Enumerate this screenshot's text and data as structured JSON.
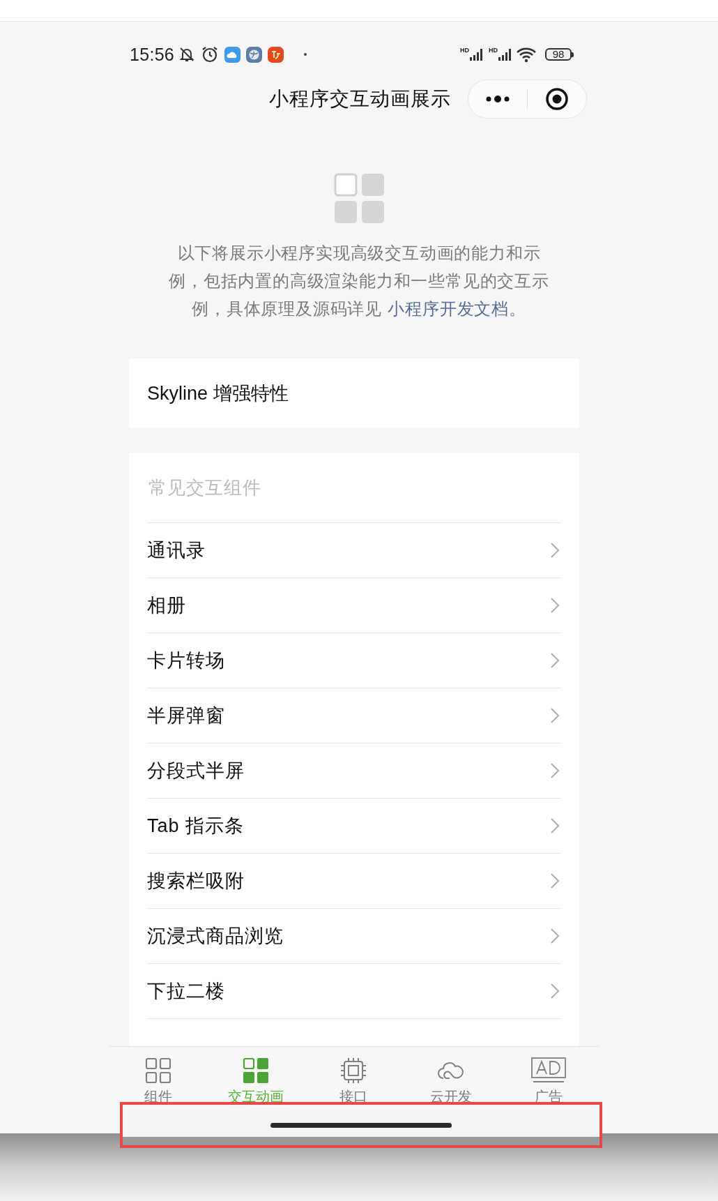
{
  "status_bar": {
    "time": "15:56",
    "signal_labels": [
      "HD",
      "HD"
    ],
    "battery": "98"
  },
  "nav_bar": {
    "title": "小程序交互动画展示"
  },
  "intro": {
    "lines": [
      "以下将展示小程序实现高级交互动画的能力和示",
      "例，包括内置的高级渲染能力和一些常见的交互示",
      "例，具体原理及源码详见 "
    ],
    "link": "小程序开发文档",
    "tail": "。"
  },
  "feature_card": {
    "label": "Skyline 增强特性"
  },
  "list": {
    "header": "常见交互组件",
    "items": [
      {
        "label": "通讯录"
      },
      {
        "label": "相册"
      },
      {
        "label": "卡片转场"
      },
      {
        "label": "半屏弹窗"
      },
      {
        "label": "分段式半屏"
      },
      {
        "label": "Tab 指示条"
      },
      {
        "label": "搜索栏吸附"
      },
      {
        "label": "沉浸式商品浏览"
      },
      {
        "label": "下拉二楼"
      }
    ]
  },
  "tab_bar": [
    {
      "label": "组件",
      "selected": false
    },
    {
      "label": "交互动画",
      "selected": true
    },
    {
      "label": "接口",
      "selected": false
    },
    {
      "label": "云开发",
      "selected": false
    },
    {
      "label": "广告",
      "selected": false
    }
  ],
  "annotation": {
    "kind": "outline"
  }
}
